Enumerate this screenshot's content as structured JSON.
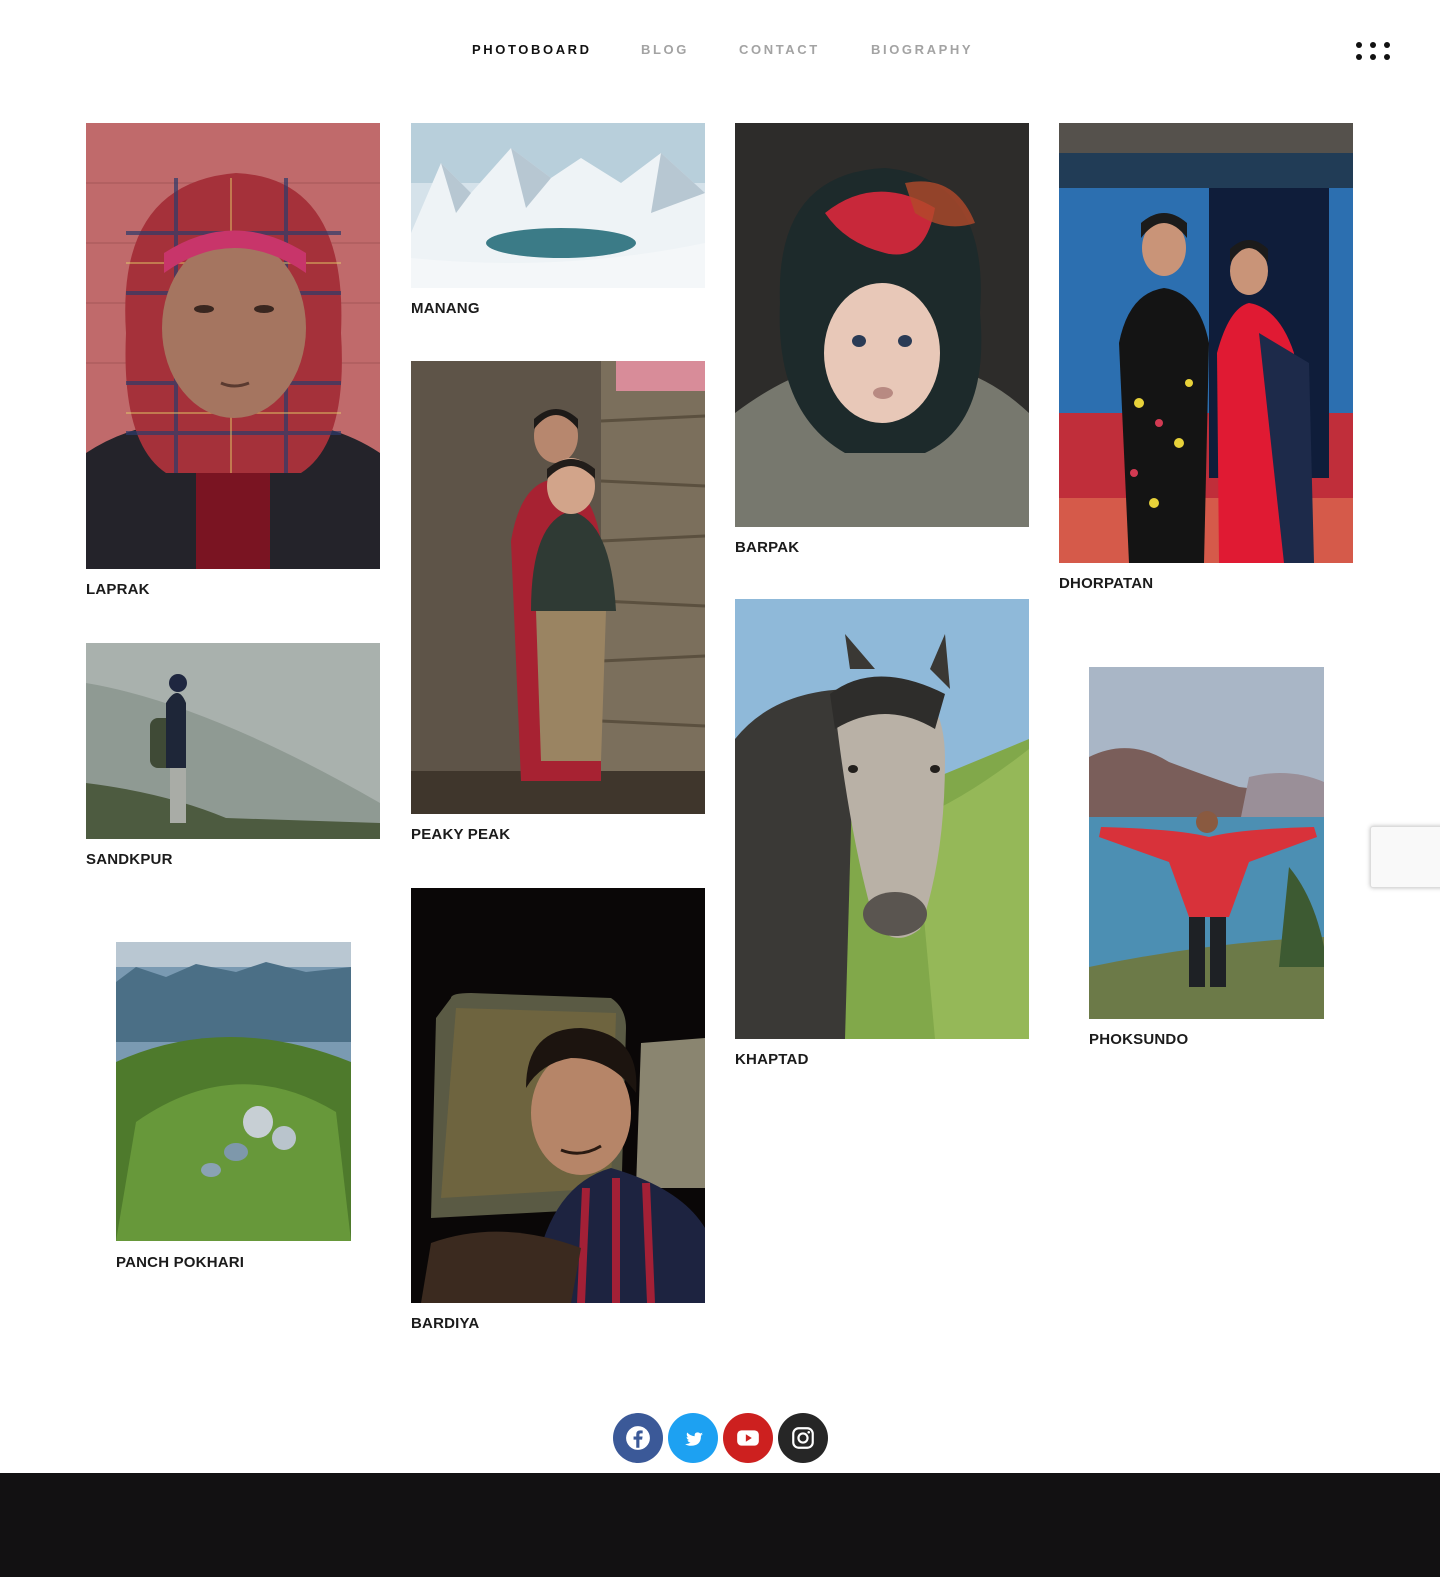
{
  "nav": {
    "items": [
      {
        "label": "PHOTOBOARD",
        "active": true
      },
      {
        "label": "BLOG",
        "active": false
      },
      {
        "label": "CONTACT",
        "active": false
      },
      {
        "label": "BIOGRAPHY",
        "active": false
      }
    ],
    "menu_icon": "dots-grid-icon"
  },
  "gallery": {
    "items": [
      {
        "caption": "LAPRAK",
        "photo": "woman-plaid-headscarf"
      },
      {
        "caption": "MANANG",
        "photo": "snowy-mountain-lake"
      },
      {
        "caption": "BARPAK",
        "photo": "child-in-headscarf"
      },
      {
        "caption": "DHORPATAN",
        "photo": "two-women-traditional-dress"
      },
      {
        "caption": "SANDKPUR",
        "photo": "hiker-in-fog"
      },
      {
        "caption": "PEAKY PEAK",
        "photo": "two-children-stone-wall"
      },
      {
        "caption": "KHAPTAD",
        "photo": "horse-portrait"
      },
      {
        "caption": "PHOKSUNDO",
        "photo": "man-arms-open-by-lake"
      },
      {
        "caption": "PANCH POKHARI",
        "photo": "aerial-green-ridge-lakes"
      },
      {
        "caption": "BARDIYA",
        "photo": "young-man-at-window"
      }
    ]
  },
  "social": [
    {
      "name": "facebook-icon",
      "color": "#3b5998"
    },
    {
      "name": "twitter-icon",
      "color": "#1da1f2"
    },
    {
      "name": "youtube-icon",
      "color": "#cd201f"
    },
    {
      "name": "instagram-icon",
      "color": "#262626"
    }
  ],
  "colors": {
    "footer": "#121112",
    "active_nav": "#111111",
    "inactive_nav": "#a3a3a3"
  }
}
